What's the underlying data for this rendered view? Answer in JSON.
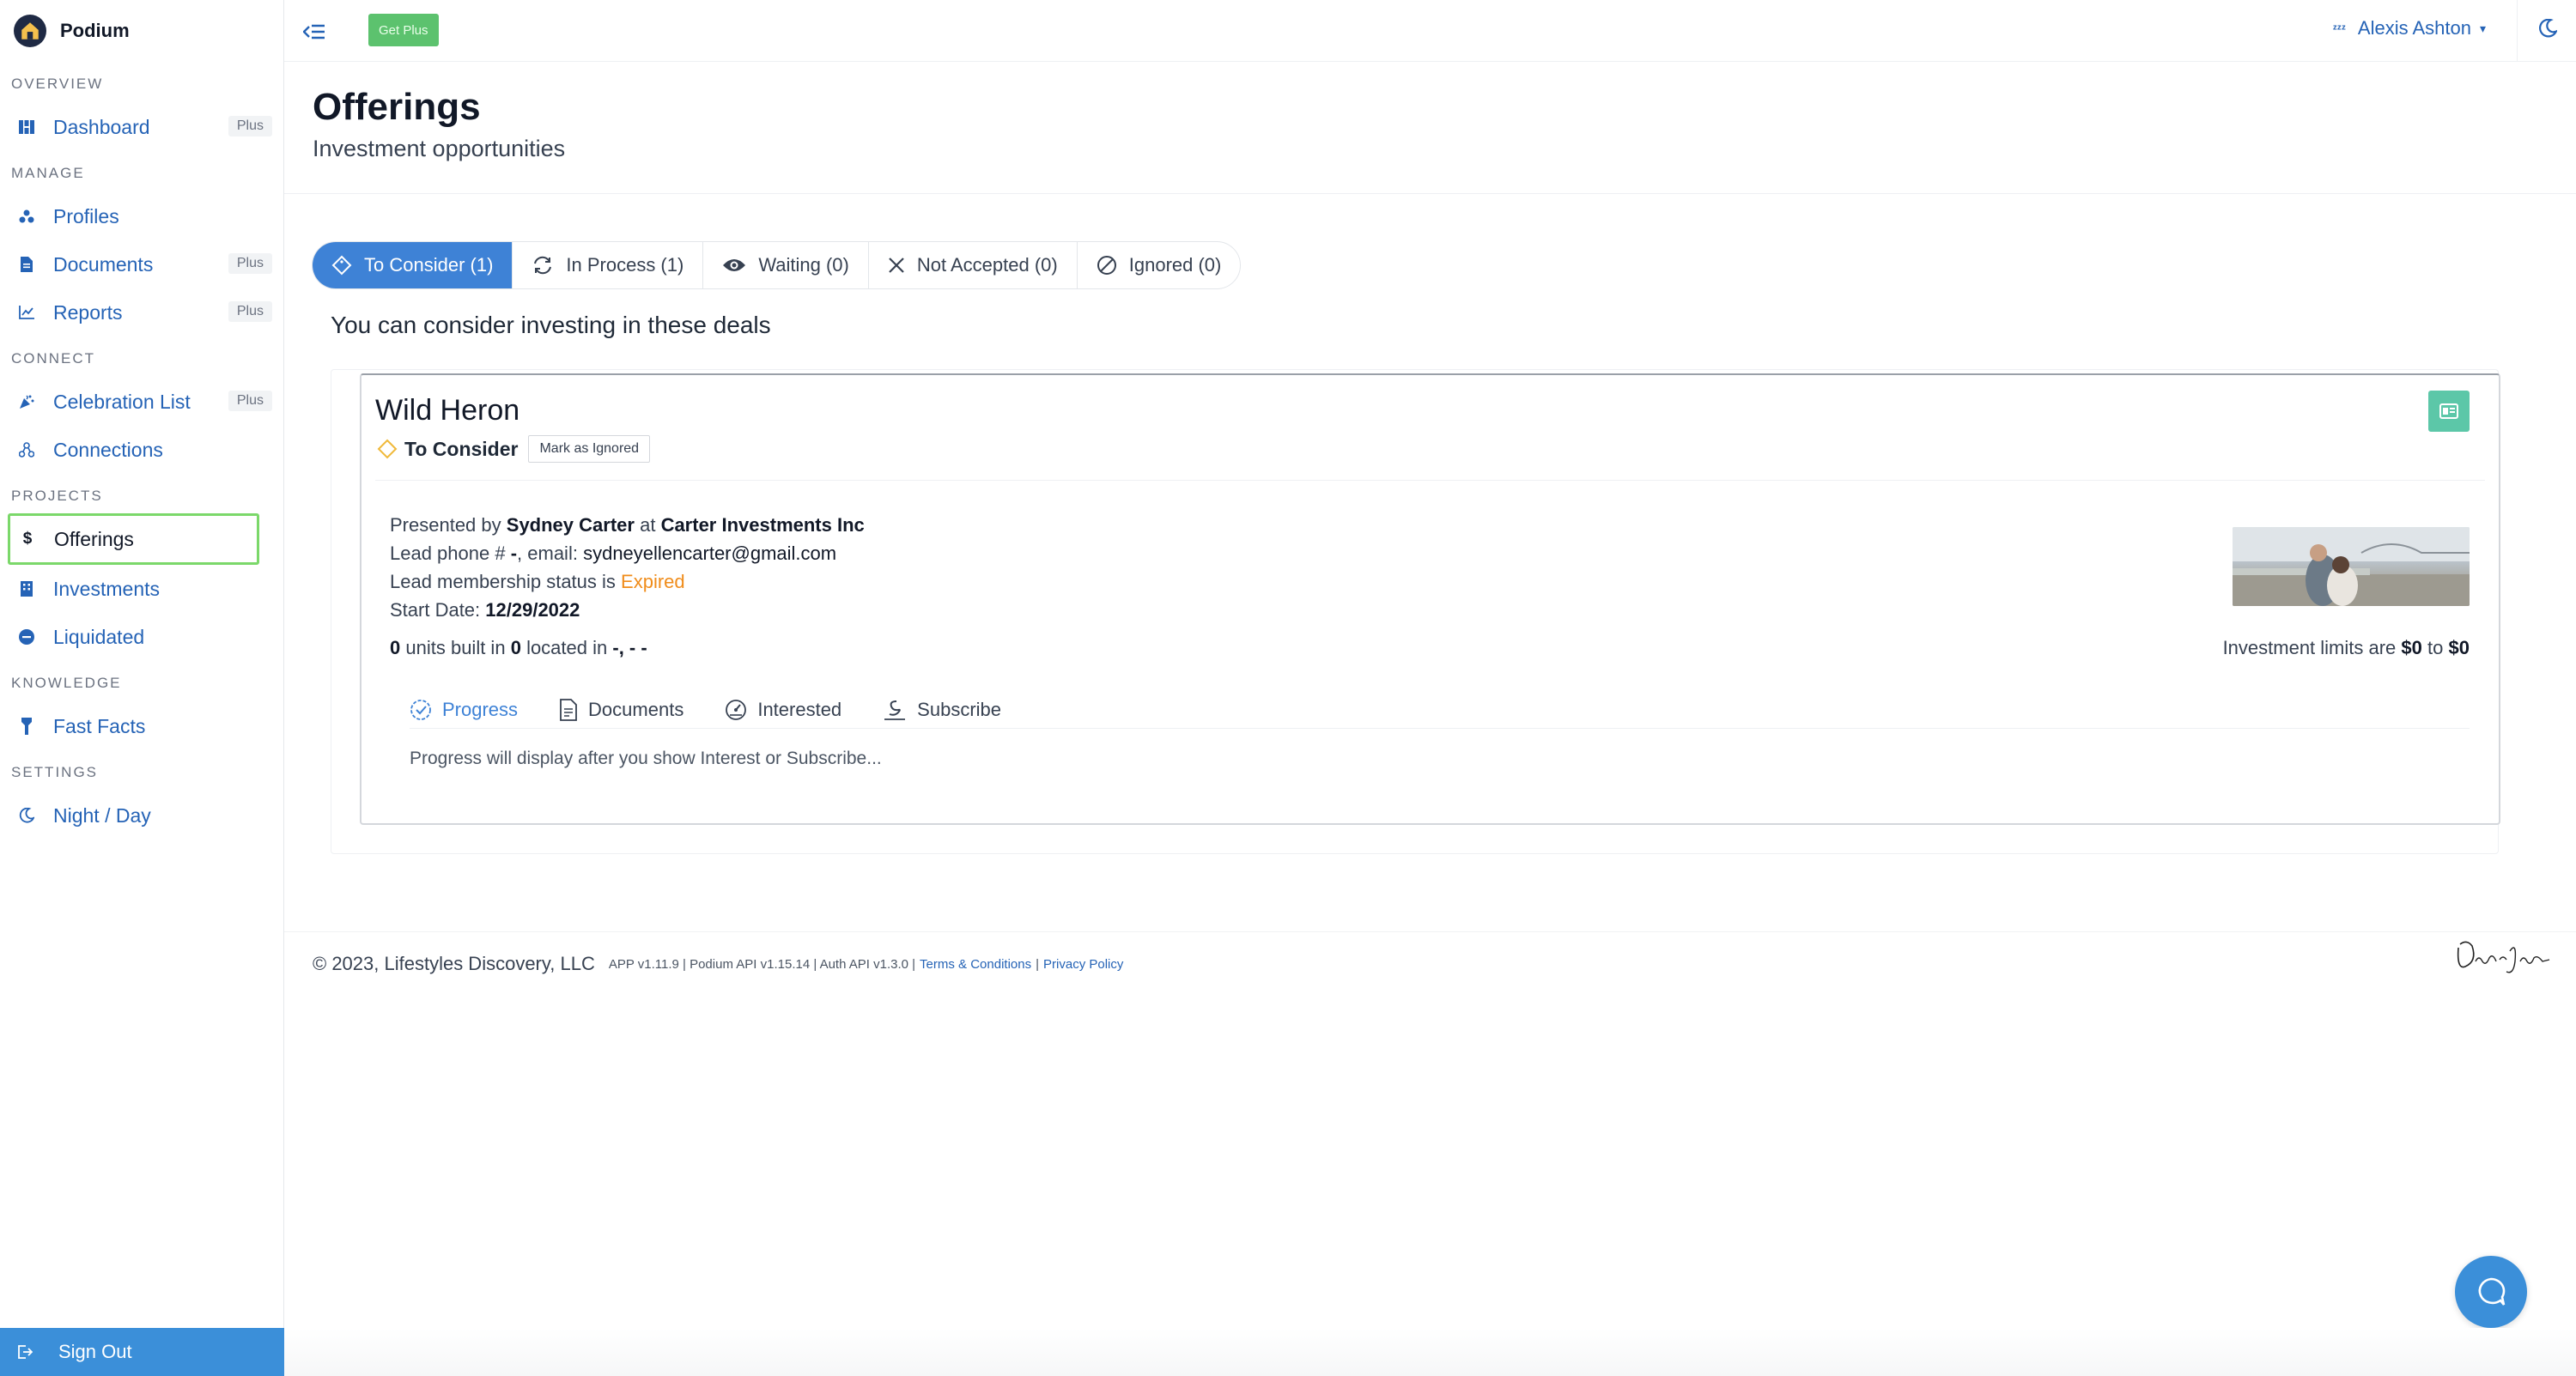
{
  "brand": {
    "name": "Podium"
  },
  "sidebar": {
    "sections": [
      {
        "title": "OVERVIEW",
        "items": [
          {
            "label": "Dashboard",
            "icon": "dashboard-icon",
            "badge": "Plus"
          }
        ]
      },
      {
        "title": "MANAGE",
        "items": [
          {
            "label": "Profiles",
            "icon": "profiles-icon"
          },
          {
            "label": "Documents",
            "icon": "document-icon",
            "badge": "Plus"
          },
          {
            "label": "Reports",
            "icon": "chart-icon",
            "badge": "Plus"
          }
        ]
      },
      {
        "title": "CONNECT",
        "items": [
          {
            "label": "Celebration List",
            "icon": "party-icon",
            "badge": "Plus"
          },
          {
            "label": "Connections",
            "icon": "connections-icon"
          }
        ]
      },
      {
        "title": "PROJECTS",
        "items": [
          {
            "label": "Offerings",
            "icon": "dollar-icon",
            "active": true
          },
          {
            "label": "Investments",
            "icon": "building-icon"
          },
          {
            "label": "Liquidated",
            "icon": "minus-circle-icon"
          }
        ]
      },
      {
        "title": "KNOWLEDGE",
        "items": [
          {
            "label": "Fast Facts",
            "icon": "flashlight-icon"
          }
        ]
      },
      {
        "title": "SETTINGS",
        "items": [
          {
            "label": "Night / Day",
            "icon": "moon-icon"
          }
        ]
      }
    ],
    "signout_label": "Sign Out"
  },
  "topbar": {
    "get_plus_label": "Get Plus",
    "user_name": "Alexis Ashton",
    "user_status_icon": "zzz-icon"
  },
  "page": {
    "title": "Offerings",
    "subtitle": "Investment opportunities"
  },
  "tabs": [
    {
      "label": "To Consider (1)",
      "icon": "tag-icon",
      "active": true
    },
    {
      "label": "In Process (1)",
      "icon": "refresh-icon"
    },
    {
      "label": "Waiting (0)",
      "icon": "eye-icon"
    },
    {
      "label": "Not Accepted (0)",
      "icon": "x-icon"
    },
    {
      "label": "Ignored (0)",
      "icon": "ban-icon"
    }
  ],
  "deals_heading": "You can consider investing in these deals",
  "deal": {
    "name": "Wild Heron",
    "status": "To Consider",
    "mark_ignored_label": "Mark as Ignored",
    "presented_prefix": "Presented by",
    "presenter": "Sydney Carter",
    "at": "at",
    "company": "Carter Investments Inc",
    "phone_prefix": "Lead phone #",
    "phone": "-",
    "email_prefix": ", email:",
    "email": "sydneyellencarter@gmail.com",
    "membership_prefix": "Lead membership status is",
    "membership_status": "Expired",
    "start_prefix": "Start Date:",
    "start_date": "12/29/2022",
    "units": "0",
    "units_text": "units built in",
    "built_count": "0",
    "located_text": "located in",
    "location": "-, - -",
    "limits_prefix": "Investment limits are",
    "limit_min": "$0",
    "limits_to": "to",
    "limit_max": "$0",
    "subtabs": [
      {
        "label": "Progress",
        "icon": "check-circle-icon",
        "active": true
      },
      {
        "label": "Documents",
        "icon": "file-icon"
      },
      {
        "label": "Interested",
        "icon": "gauge-icon"
      },
      {
        "label": "Subscribe",
        "icon": "signature-icon"
      }
    ],
    "progress_message": "Progress will display after you show Interest or Subscribe..."
  },
  "footer": {
    "copyright": "© 2023, Lifestyles Discovery, LLC",
    "versions": "APP v1.11.9 | Podium API v1.15.14 | Auth API v1.3.0 |",
    "terms": "Terms & Conditions",
    "divider": "|",
    "privacy": "Privacy Policy"
  },
  "colors": {
    "accent": "#3e82d6",
    "link": "#2563b6",
    "active_outline": "#7bd86a",
    "get_plus": "#5cc26e",
    "expired": "#f08c1a",
    "signout_bg": "#3b8fd9"
  }
}
